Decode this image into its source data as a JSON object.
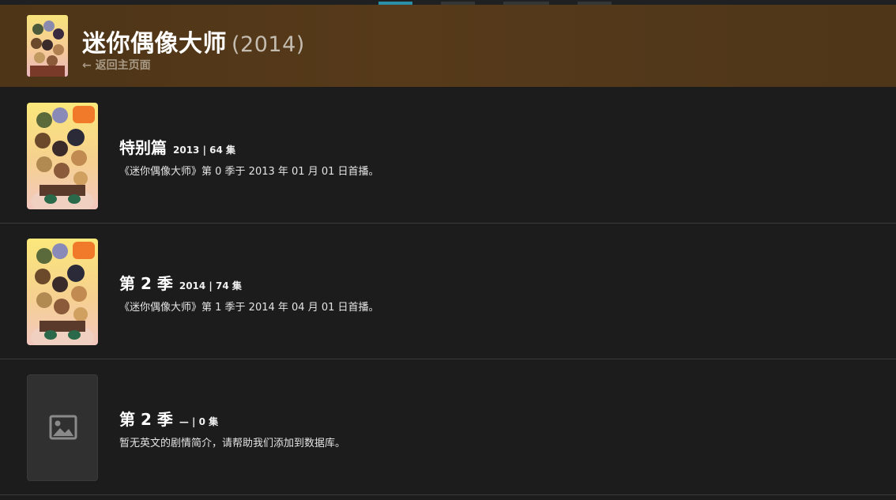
{
  "topbar": {
    "active_tab": 0
  },
  "header": {
    "title": "迷你偶像大师",
    "year": "(2014)",
    "back_label": "返回主页面",
    "back_icon": "arrow-left-icon",
    "background_color": "#553919"
  },
  "seasons": [
    {
      "name": "特别篇",
      "meta": "2013 | 64 集",
      "description": "《迷你偶像大师》第 0 季于 2013 年 01 月 01 日首播。",
      "has_poster": true
    },
    {
      "name": "第 2 季",
      "meta": "2014 | 74 集",
      "description": "《迷你偶像大师》第 1 季于 2014 年 04 月 01 日首播。",
      "has_poster": true
    },
    {
      "name": "第 2 季",
      "meta": "— | 0 集",
      "description": "暂无英文的剧情简介，请帮助我们添加到数据库。",
      "has_poster": false,
      "placeholder_icon": "image-placeholder-icon"
    }
  ],
  "colors": {
    "accent": "#2a8fa8",
    "background": "#1c1c1c"
  }
}
